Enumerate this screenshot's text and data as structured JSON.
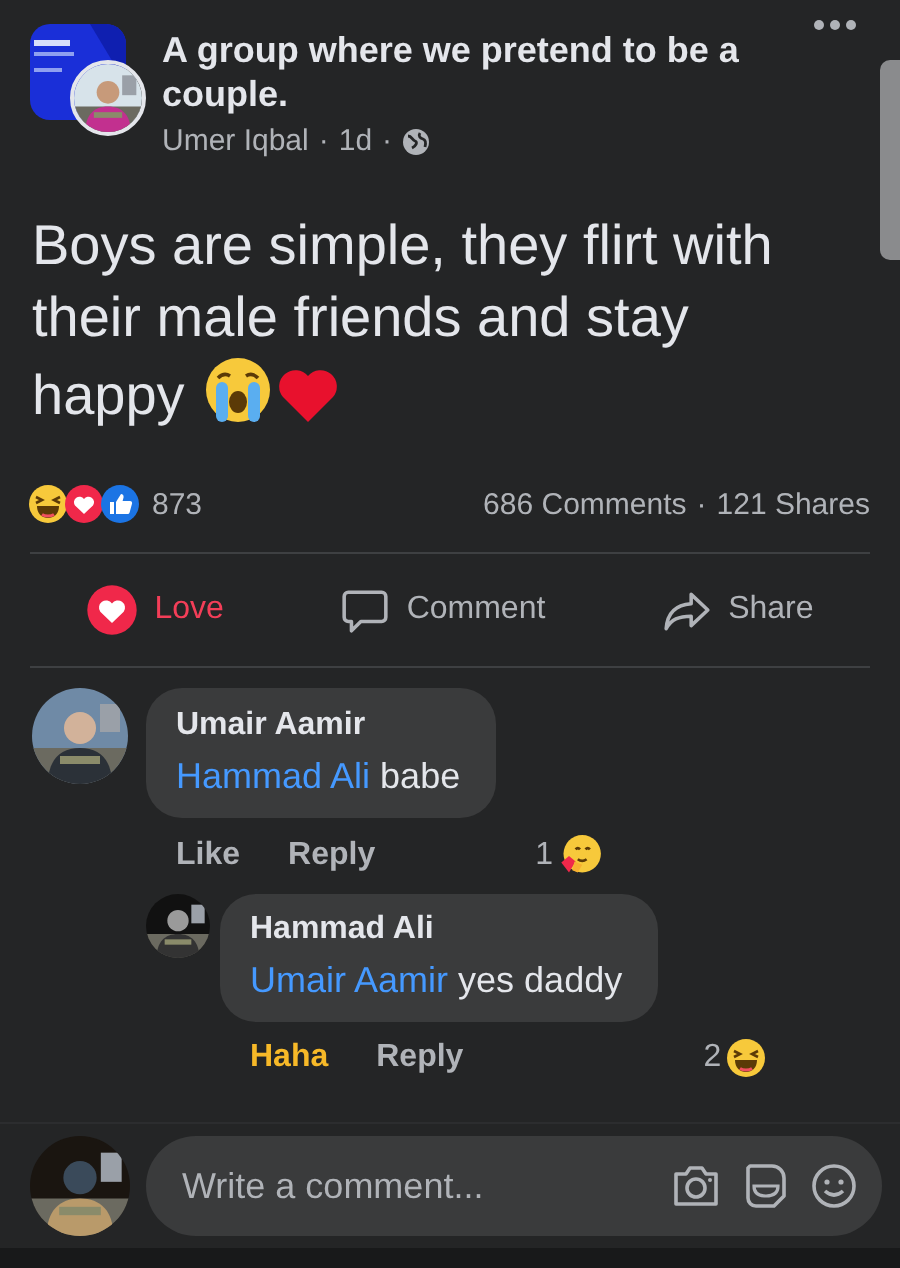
{
  "post": {
    "group": "A group where we pretend to be a couple.",
    "author": "Umer Iqbal",
    "time": "1d",
    "separator": "·",
    "text": "Boys are simple, they flirt with their male friends and stay happy"
  },
  "reactions": {
    "count": "873",
    "comments": "686 Comments",
    "separator": "·",
    "shares": "121 Shares"
  },
  "actions": [
    {
      "kind": "love",
      "label": "Love",
      "selected": true
    },
    {
      "kind": "comment",
      "label": "Comment",
      "selected": false
    },
    {
      "kind": "share",
      "label": "Share",
      "selected": false
    }
  ],
  "comments": [
    {
      "author": "Umair Aamir",
      "mention": "Hammad Ali",
      "text": "babe",
      "reaction": {
        "kind": "none",
        "label": "Like"
      },
      "reply_label": "Reply",
      "count": {
        "kind": "hug",
        "label": "1"
      },
      "replies": [
        {
          "author": "Hammad Ali",
          "mention": "Umair Aamir",
          "text": "yes daddy",
          "reaction": {
            "kind": "haha",
            "label": "Haha"
          },
          "reply_label": "Reply",
          "count": {
            "kind": "haha",
            "label": "2"
          }
        }
      ]
    }
  ],
  "composer": {
    "placeholder": "Write a comment..."
  }
}
